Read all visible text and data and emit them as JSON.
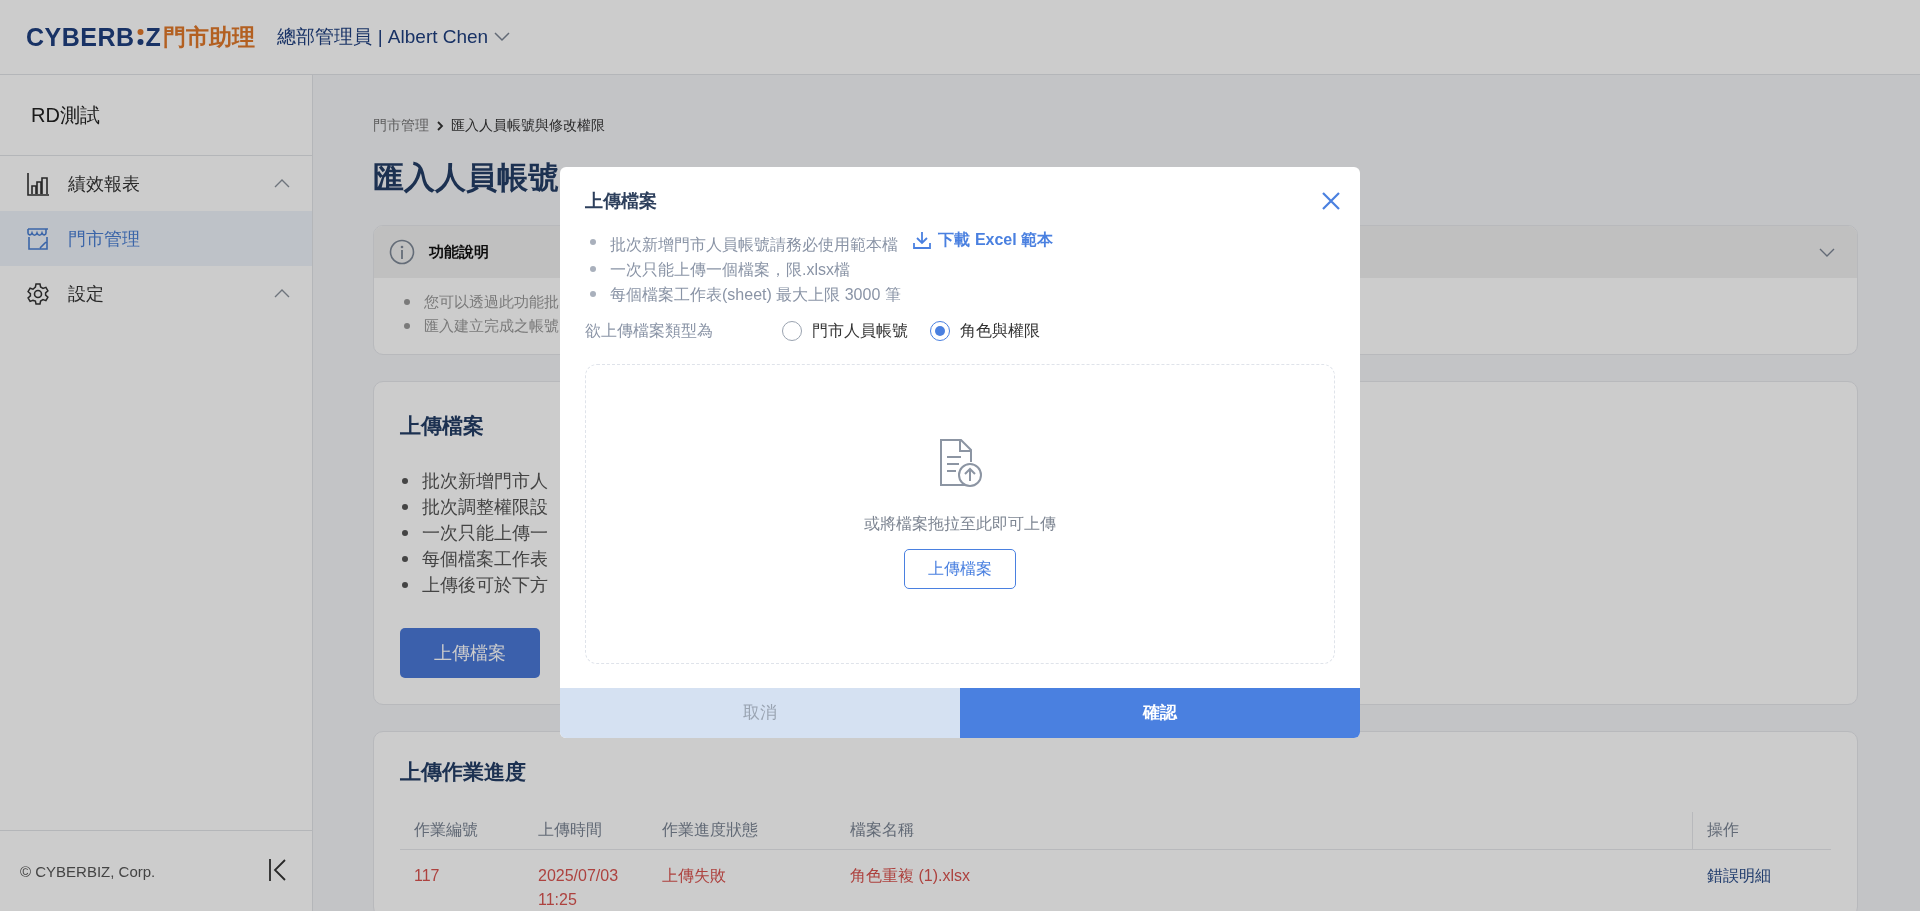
{
  "header": {
    "logo": {
      "left": "CYBERB",
      "right": "Z",
      "suffix": "門市助理"
    },
    "user": "總部管理員 | Albert Chen"
  },
  "sidebar": {
    "store": "RD測試",
    "items": [
      {
        "label": "績效報表",
        "kind": "group",
        "selected": false
      },
      {
        "label": "門市管理",
        "kind": "link",
        "selected": true
      },
      {
        "label": "設定",
        "kind": "group",
        "selected": false
      }
    ],
    "footer": "© CYBERBIZ, Corp."
  },
  "breadcrumb": [
    "門市管理",
    "匯入人員帳號與修改權限"
  ],
  "page_title": "匯入人員帳號",
  "info_panel": {
    "title": "功能說明",
    "items": [
      "您可以透過此功能批",
      "匯入建立完成之帳號"
    ]
  },
  "upload_card": {
    "title": "上傳檔案",
    "items": [
      "批次新增門市人",
      "批次調整權限設",
      "一次只能上傳一",
      "每個檔案工作表",
      "上傳後可於下方"
    ],
    "button": "上傳檔案"
  },
  "progress": {
    "title": "上傳作業進度",
    "columns": [
      "作業編號",
      "上傳時間",
      "作業進度狀態",
      "檔案名稱",
      "操作"
    ],
    "rows": [
      {
        "kind": "error",
        "cells": [
          "117",
          "2025/07/03 11:25",
          "上傳失敗",
          "角色重複 (1).xlsx"
        ],
        "action": "錯誤明細"
      }
    ]
  },
  "modal": {
    "title": "上傳檔案",
    "notes": [
      {
        "text": "批次新增門市人員帳號請務必使用範本檔",
        "link": "下載 Excel 範本"
      },
      {
        "text": "一次只能上傳一個檔案，限.xlsx檔"
      },
      {
        "text": "每個檔案工作表(sheet) 最大上限 3000 筆"
      }
    ],
    "type_label": "欲上傳檔案類型為",
    "options": [
      {
        "label": "門市人員帳號",
        "selected": false
      },
      {
        "label": "角色與權限",
        "selected": true
      }
    ],
    "dropzone": {
      "hint": "或將檔案拖拉至此即可上傳",
      "button": "上傳檔案"
    },
    "cancel": "取消",
    "confirm": "確認"
  }
}
